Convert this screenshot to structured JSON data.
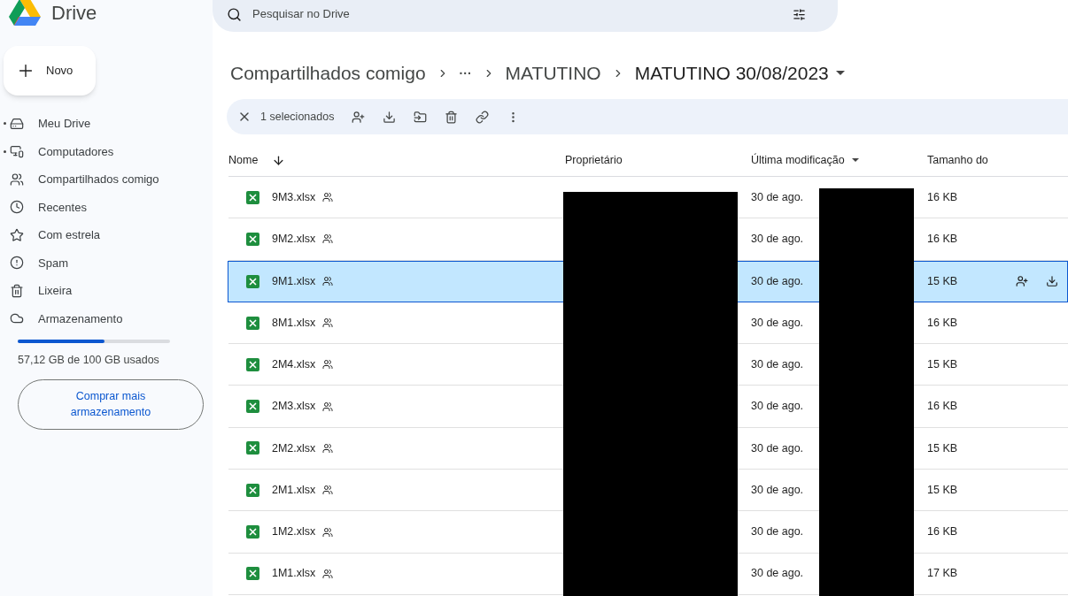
{
  "app": {
    "name": "Drive"
  },
  "search": {
    "placeholder": "Pesquisar no Drive"
  },
  "new_button": {
    "label": "Novo"
  },
  "sidebar": {
    "items": [
      {
        "kind": "drive",
        "label": "Meu Drive",
        "expandable": true
      },
      {
        "kind": "computers",
        "label": "Computadores",
        "expandable": true
      },
      {
        "kind": "shared",
        "label": "Compartilhados comigo",
        "expandable": false
      },
      {
        "kind": "recent",
        "label": "Recentes",
        "expandable": false
      },
      {
        "kind": "starred",
        "label": "Com estrela",
        "expandable": false
      },
      {
        "kind": "spam",
        "label": "Spam",
        "expandable": false
      },
      {
        "kind": "trash",
        "label": "Lixeira",
        "expandable": false
      },
      {
        "kind": "storage",
        "label": "Armazenamento",
        "expandable": false
      }
    ]
  },
  "storage": {
    "level": 0.5712,
    "usage": "57,12 GB de 100 GB usados",
    "button": "Comprar mais armazenamento"
  },
  "breadcrumb": [
    {
      "kind": "folder",
      "label": "Compartilhados comigo"
    },
    {
      "kind": "more",
      "label": "···"
    },
    {
      "kind": "folder",
      "label": "MATUTINO"
    },
    {
      "kind": "current",
      "label": "MATUTINO 30/08/2023"
    }
  ],
  "selection_bar": {
    "count": "1 selecionados"
  },
  "table": {
    "columns": [
      "Nome",
      "Proprietário",
      "Última modificação",
      "Tamanho do"
    ],
    "rows": [
      {
        "name": "9M3.xlsx",
        "modified": "30 de ago.",
        "size": "16 KB",
        "selected": false
      },
      {
        "name": "9M2.xlsx",
        "modified": "30 de ago.",
        "size": "16 KB",
        "selected": false
      },
      {
        "name": "9M1.xlsx",
        "modified": "30 de ago.",
        "size": "15 KB",
        "selected": true
      },
      {
        "name": "8M1.xlsx",
        "modified": "30 de ago.",
        "size": "16 KB",
        "selected": false
      },
      {
        "name": "2M4.xlsx",
        "modified": "30 de ago.",
        "size": "15 KB",
        "selected": false
      },
      {
        "name": "2M3.xlsx",
        "modified": "30 de ago.",
        "size": "16 KB",
        "selected": false
      },
      {
        "name": "2M2.xlsx",
        "modified": "30 de ago.",
        "size": "15 KB",
        "selected": false
      },
      {
        "name": "2M1.xlsx",
        "modified": "30 de ago.",
        "size": "15 KB",
        "selected": false
      },
      {
        "name": "1M2.xlsx",
        "modified": "30 de ago.",
        "size": "16 KB",
        "selected": false
      },
      {
        "name": "1M1.xlsx",
        "modified": "30 de ago.",
        "size": "17 KB",
        "selected": false
      }
    ]
  }
}
